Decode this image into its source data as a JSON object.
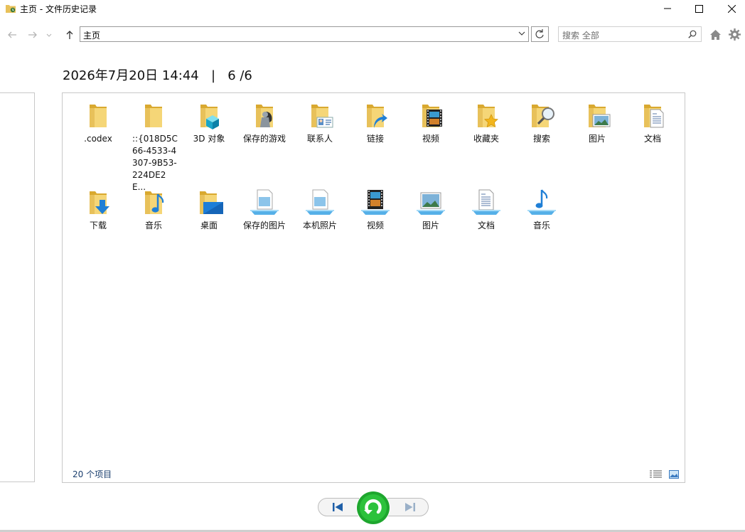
{
  "window": {
    "title": "主页 - 文件历史记录"
  },
  "toolbar": {
    "address": "主页",
    "search_placeholder": "搜索 全部"
  },
  "snapshot": {
    "date": "2026年7月20日 14:44",
    "separator": "|",
    "position": "6 /6"
  },
  "items_row1": [
    {
      "label": ".codex",
      "icon": "folder-icon"
    },
    {
      "label": "::{018D5C66-4533-4307-9B53-224DE2E...",
      "icon": "folder-icon"
    },
    {
      "label": "3D 对象",
      "icon": "folder-3d-icon"
    },
    {
      "label": "保存的游戏",
      "icon": "folder-games-icon"
    },
    {
      "label": "联系人",
      "icon": "folder-contacts-icon"
    },
    {
      "label": "链接",
      "icon": "folder-links-icon"
    },
    {
      "label": "视频",
      "icon": "folder-videos-icon"
    },
    {
      "label": "收藏夹",
      "icon": "folder-favorites-icon"
    },
    {
      "label": "搜索",
      "icon": "folder-search-icon"
    },
    {
      "label": "图片",
      "icon": "folder-pictures-icon"
    },
    {
      "label": "文档",
      "icon": "folder-documents-icon"
    }
  ],
  "items_row2": [
    {
      "label": "下载",
      "icon": "folder-downloads-icon"
    },
    {
      "label": "音乐",
      "icon": "folder-music-icon"
    },
    {
      "label": "桌面",
      "icon": "folder-desktop-icon"
    },
    {
      "label": "保存的图片",
      "icon": "library-saved-pictures-icon"
    },
    {
      "label": "本机照片",
      "icon": "library-camera-roll-icon"
    },
    {
      "label": "视频",
      "icon": "library-videos-icon"
    },
    {
      "label": "图片",
      "icon": "library-pictures-icon"
    },
    {
      "label": "文档",
      "icon": "library-documents-icon"
    },
    {
      "label": "音乐",
      "icon": "library-music-icon"
    }
  ],
  "status": {
    "item_count": "20 个项目"
  }
}
